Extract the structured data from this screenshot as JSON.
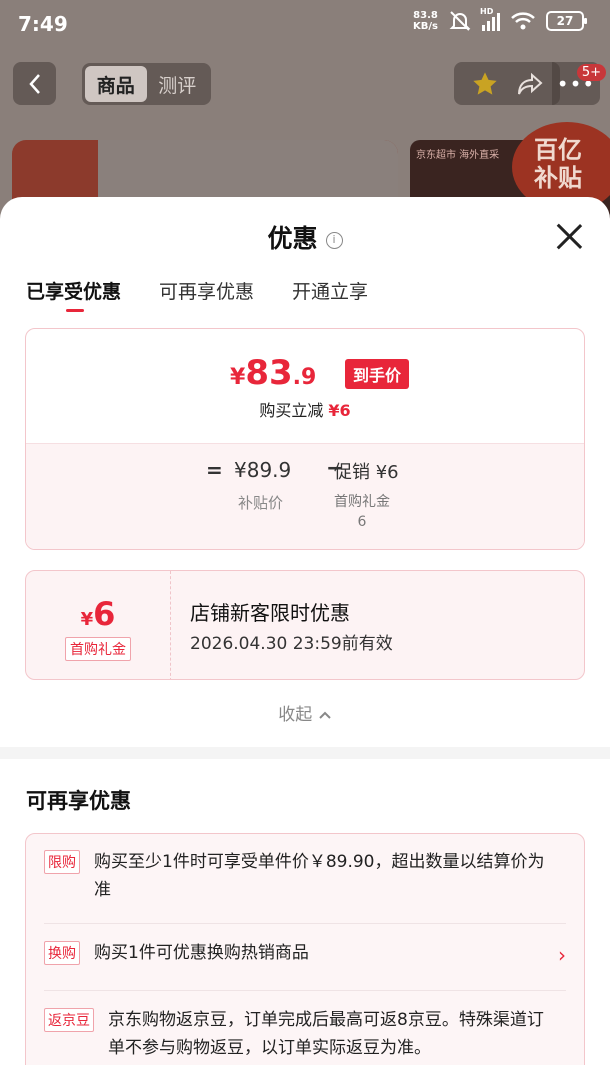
{
  "status_bar": {
    "time": "7:49",
    "speed_value": "83.8",
    "speed_unit": "KB/s",
    "hd": "HD",
    "battery": "27"
  },
  "top_bar": {
    "tabs": [
      "商品",
      "测评"
    ],
    "active_tab": "商品",
    "cart_badge": "5+",
    "bg_tagline": "京东超市  海外直采",
    "subsidy_line1": "百亿",
    "subsidy_line2": "补贴"
  },
  "sheet": {
    "title": "优惠",
    "tabs": [
      "已享受优惠",
      "可再享优惠",
      "开通立享"
    ],
    "price": {
      "currency": "¥",
      "integer": "83",
      "decimal": ".9",
      "tag": "到手价",
      "sub_prefix": "购买立减",
      "sub_amount": "¥6",
      "equals": "=",
      "base_price": "¥89.9",
      "base_label": "补贴价",
      "minus": "−",
      "promo": "促销 ¥6",
      "promo_label_line1": "首购礼金",
      "promo_label_line2": "6"
    },
    "coupon": {
      "currency": "¥",
      "amount": "6",
      "tag": "首购礼金",
      "title": "店铺新客限时优惠",
      "validity": "2026.04.30 23:59前有效"
    },
    "collapse_label": "收起",
    "more_section_title": "可再享优惠",
    "benefits": [
      {
        "tag": "限购",
        "text": "购买至少1件时可享受单件价￥89.90，超出数量以结算价为准"
      },
      {
        "tag": "换购",
        "text": "购买1件可优惠换购热销商品"
      },
      {
        "tag": "返京豆",
        "text": "京东购物返京豆，订单完成后最高可返8京豆。特殊渠道订单不参与购物返豆，以订单实际返豆为准。"
      }
    ]
  }
}
